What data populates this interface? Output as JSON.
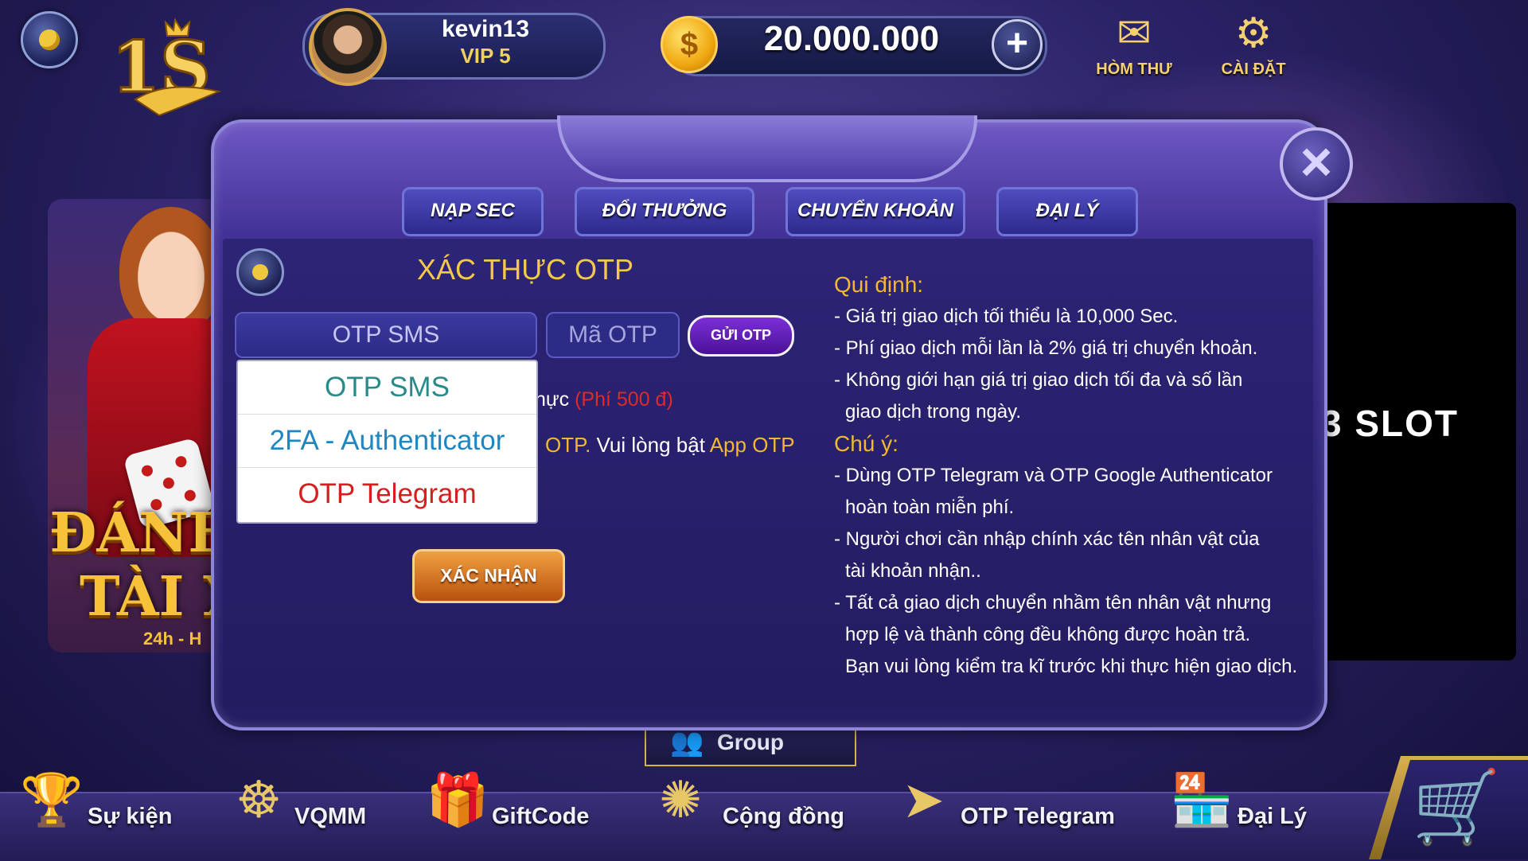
{
  "header": {
    "username": "kevin13",
    "vip": "VIP 5",
    "balance": "20.000.000",
    "mail_label": "HÒM THƯ",
    "settings_label": "CÀI ĐẶT"
  },
  "banner": {
    "line1": "ĐÁNH",
    "line2": "TÀI X",
    "sub": "24h - H"
  },
  "right_panel": {
    "text": "3 SLOT"
  },
  "modal": {
    "tabs": [
      "NẠP SEC",
      "ĐỔI THƯỞNG",
      "CHUYỂN KHOẢN",
      "ĐẠI LÝ"
    ],
    "title": "XÁC THỰC OTP",
    "otp_type_selected": "OTP SMS",
    "otp_input_placeholder": "Mã OTP",
    "send_otp_label": "GỬI OTP",
    "dropdown_options": [
      "OTP SMS",
      "2FA - Authenticator",
      "OTP Telegram"
    ],
    "fee_prefix": "hực",
    "fee_text": "(Phí 500 đ)",
    "note_otp": "OTP.",
    "note_text": " Vui lòng bật ",
    "note_app": "App OTP",
    "confirm_label": "XÁC NHẬN",
    "rules_heading": "Qui định:",
    "rules": [
      "- Giá trị giao dịch tối thiểu là 10,000 Sec.",
      "- Phí giao dịch mỗi lần là 2% giá trị chuyển khoản.",
      "- Không giới hạn giá trị giao dịch tối đa và số lần",
      "giao dịch trong ngày."
    ],
    "notes_heading": "Chú ý:",
    "notes": [
      "- Dùng OTP Telegram và OTP Google Authenticator",
      "hoàn toàn miễn phí.",
      "- Người chơi cần nhập chính xác tên nhân vật của",
      "tài khoản nhận..",
      "- Tất cả giao dịch chuyển nhầm tên nhân vật nhưng",
      "hợp lệ và thành công đều không được hoàn trả.",
      "Bạn vui lòng kiểm tra kĩ trước khi thực hiện giao dịch."
    ]
  },
  "group_label": "Group",
  "bottom_nav": [
    "Sự kiện",
    "VQMM",
    "GiftCode",
    "Cộng đồng",
    "OTP Telegram",
    "Đại Lý"
  ],
  "icons": {
    "events": "trophy-icon",
    "wheel": "wheel-icon",
    "gift": "gift-icon",
    "community": "community-icon",
    "telegram": "telegram-icon",
    "agency": "shop-icon",
    "cart": "cart-icon"
  }
}
